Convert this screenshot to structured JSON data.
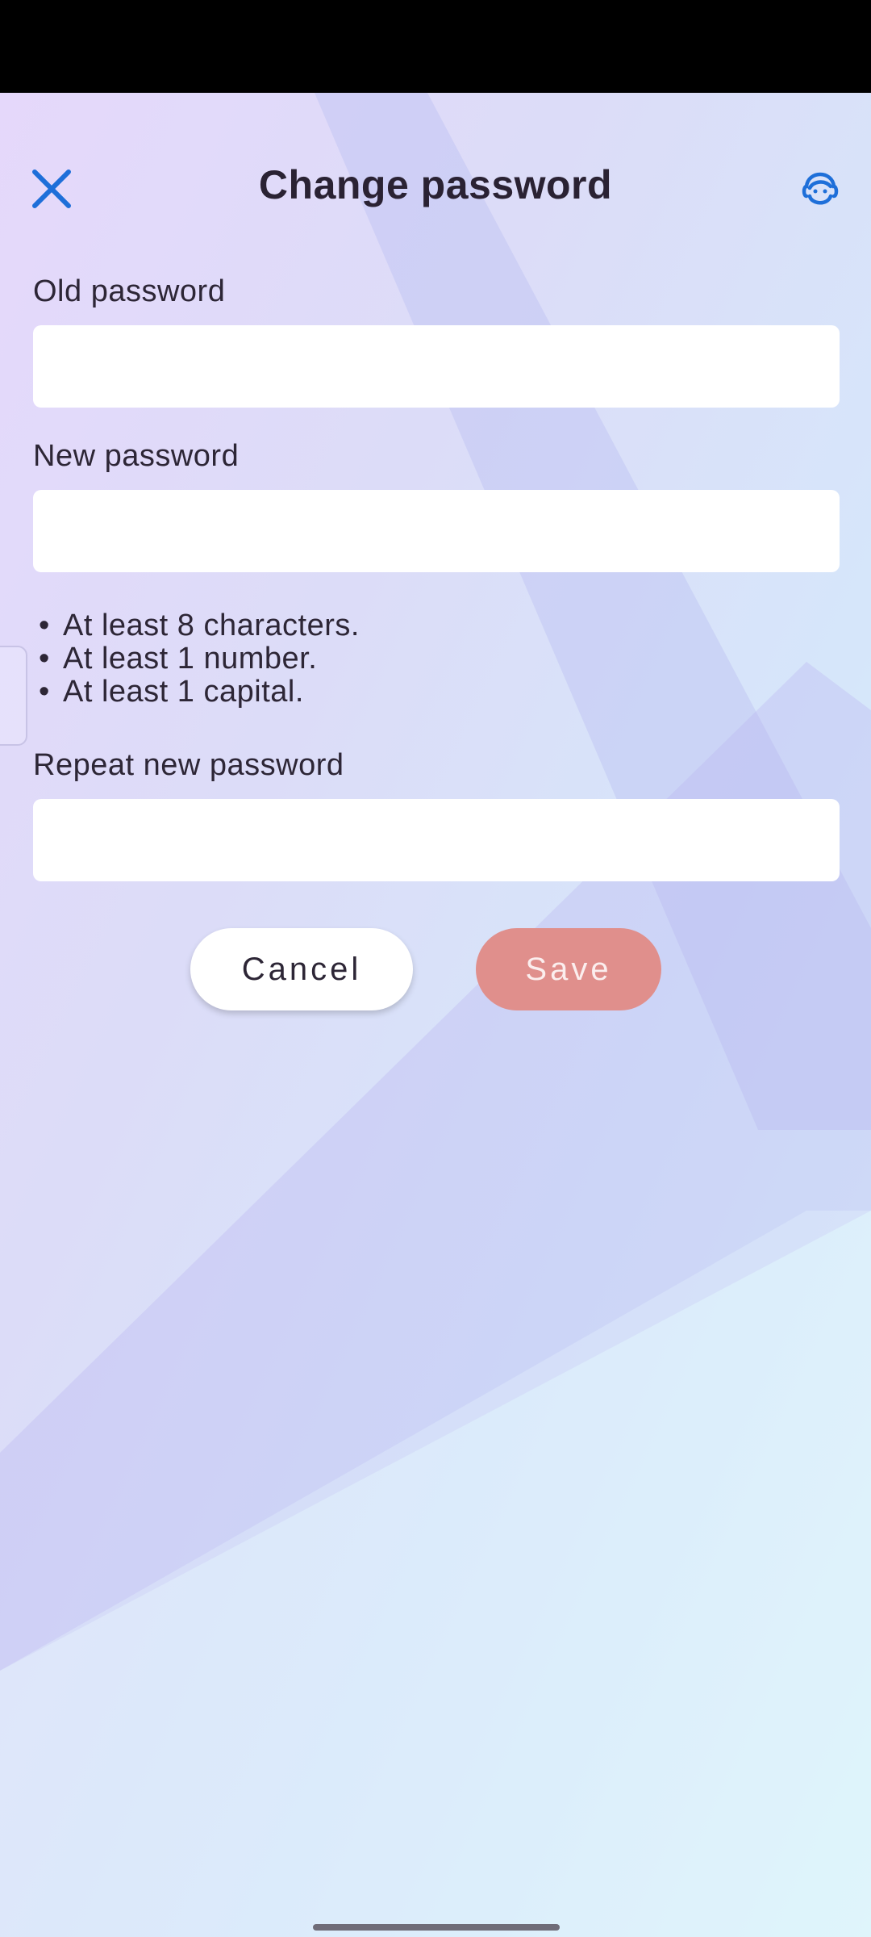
{
  "header": {
    "title": "Change password",
    "close_icon": "close-icon",
    "support_icon": "headset-support-icon"
  },
  "form": {
    "old_password": {
      "label": "Old password",
      "value": "",
      "placeholder": ""
    },
    "new_password": {
      "label": "New password",
      "value": "",
      "placeholder": ""
    },
    "rules": [
      "At least 8 characters.",
      "At least 1 number.",
      "At least 1 capital."
    ],
    "repeat_password": {
      "label": "Repeat new password",
      "value": "",
      "placeholder": ""
    }
  },
  "actions": {
    "cancel_label": "Cancel",
    "save_label": "Save"
  },
  "colors": {
    "accent_blue": "#1e6fd9",
    "save_button": "#e08f8c",
    "title_text": "#2a2233"
  }
}
